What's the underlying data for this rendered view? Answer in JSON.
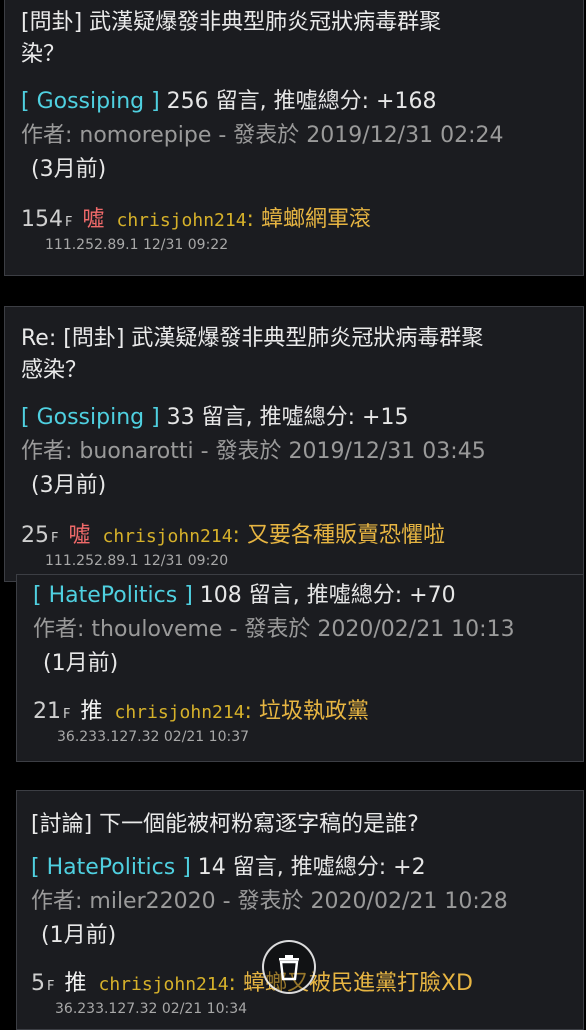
{
  "posts": [
    {
      "title_lines": [
        "[問卦] 武漢疑爆發非典型肺炎冠狀病毒群聚",
        "染？"
      ],
      "board": "[ Gossiping ]",
      "stats": " 256 留言, 推噓總分: +168",
      "author_line": "作者: nomorepipe - 發表於 2019/12/31 02:24",
      "ago": "(3月前)",
      "push": {
        "floor": "154",
        "floor_suffix": "F",
        "tag": "噓",
        "user": "chrisjohn214",
        "colon": ":",
        "message": " 蟑螂網軍滾",
        "meta": "111.252.89.1 12/31 09:22"
      }
    },
    {
      "title_lines": [
        "Re: [問卦] 武漢疑爆發非典型肺炎冠狀病毒群聚",
        "感染？"
      ],
      "board": "[ Gossiping ]",
      "stats": " 33 留言, 推噓總分: +15",
      "author_line": "作者: buonarotti - 發表於 2019/12/31 03:45",
      "ago": "(3月前)",
      "push": {
        "floor": "25",
        "floor_suffix": "F",
        "tag": "噓",
        "user": "chrisjohn214",
        "colon": ":",
        "message": " 又要各種販賣恐懼啦",
        "meta": "111.252.89.1 12/31 09:20"
      }
    },
    {
      "board": "[ HatePolitics ]",
      "stats": " 108 留言, 推噓總分: +70",
      "author_line": "作者: thouloveme - 發表於 2020/02/21 10:13",
      "ago": "(1月前)",
      "push": {
        "floor": "21",
        "floor_suffix": "F",
        "tag": "推",
        "user": "chrisjohn214",
        "colon": ":",
        "message": " 垃圾執政黨",
        "meta": "36.233.127.32 02/21 10:37"
      }
    },
    {
      "title_lines": [
        "[討論] 下一個能被柯粉寫逐字稿的是誰?"
      ],
      "board": "[ HatePolitics ]",
      "stats": " 14 留言, 推噓總分: +2",
      "author_line": "作者: miler22020 - 發表於 2020/02/21 10:28",
      "ago": "(1月前)",
      "push": {
        "floor": "5",
        "floor_suffix": "F",
        "tag": "推",
        "user": "chrisjohn214",
        "colon": ":",
        "message": " 蟑螂又被民進黨打臉XD",
        "meta": "36.233.127.32 02/21 10:34"
      }
    }
  ],
  "fab": {
    "icon": "trash-icon"
  }
}
